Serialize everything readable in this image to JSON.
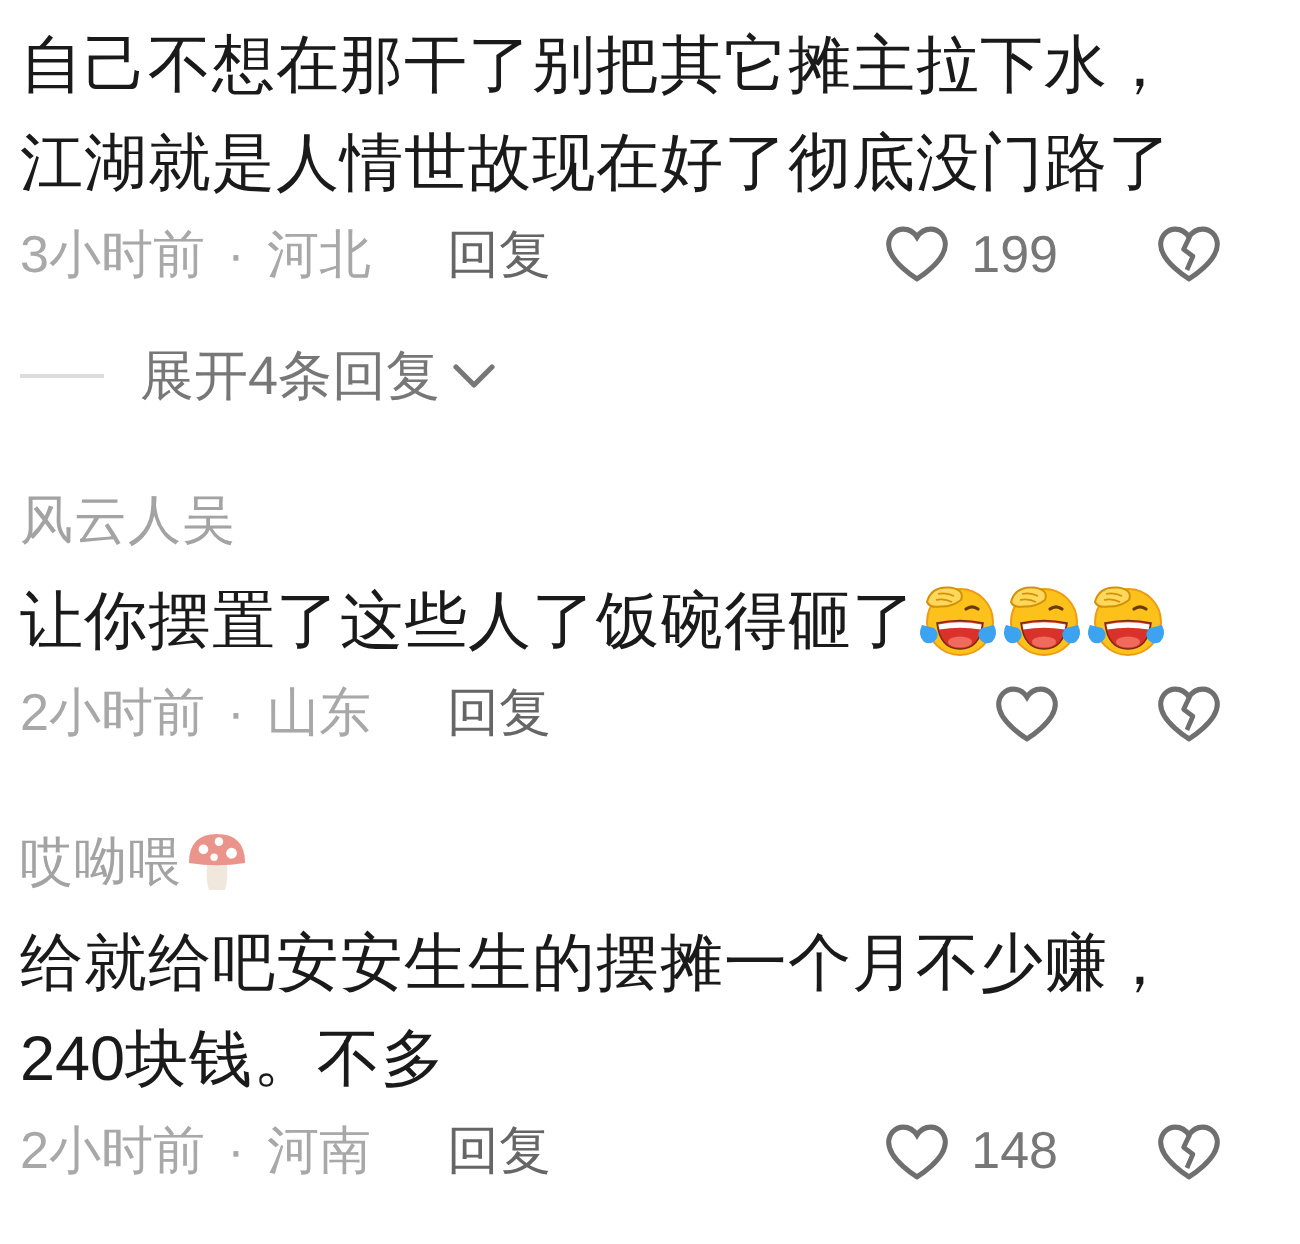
{
  "comments": [
    {
      "text": "自己不想在那干了别把其它摊主拉下水，江湖就是人情世故现在好了彻底没门路了",
      "meta": "3小时前 · 河北",
      "reply": "回复",
      "like": {
        "liked": false,
        "count": "199"
      },
      "dislike": {
        "disliked": false
      },
      "replies_toggle": {
        "label": "展开4条回复",
        "expanded": false
      }
    },
    {
      "author": "风云人吴",
      "text": "让你摆置了这些人了饭碗得砸了",
      "text_emoji": [
        {
          "kind": "laughing-tears"
        },
        {
          "kind": "laughing-tears"
        },
        {
          "kind": "laughing-tears"
        }
      ],
      "meta": "2小时前 · 山东",
      "reply": "回复",
      "like": {
        "liked": false
      },
      "dislike": {
        "disliked": false
      }
    },
    {
      "author": "哎呦喂",
      "author_emoji": [
        {
          "kind": "mushroom"
        }
      ],
      "text": "给就给吧安安生生的摆摊一个月不少赚，240块钱。不多",
      "meta": "2小时前 · 河南",
      "reply": "回复",
      "like": {
        "liked": false,
        "count": "148"
      },
      "dislike": {
        "disliked": false
      }
    }
  ]
}
